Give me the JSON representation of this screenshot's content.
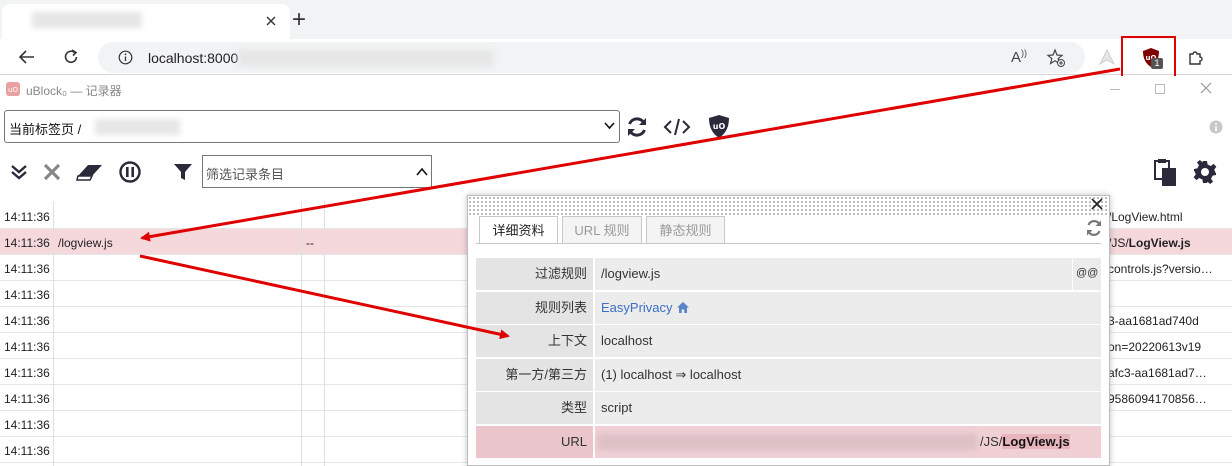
{
  "browser": {
    "address": "localhost:8000",
    "new_tab_symbol": "+",
    "extension_badge": "1"
  },
  "ublock": {
    "title": "uBlock₀ — 记录器",
    "tab_select_value": "当前标签页 / ",
    "filter_placeholder": "筛选记录条目",
    "icons": [
      "refresh-icon",
      "code-icon",
      "ublock-shield-icon",
      "expand-icon",
      "close-x-icon",
      "eraser-icon",
      "pause-icon",
      "filter-icon",
      "export-icon",
      "settings-gear-icon",
      "info-icon"
    ]
  },
  "log": {
    "rows": [
      {
        "time": "14:11:36",
        "name": "",
        "mid": "",
        "tail": "/LogView.html",
        "tail_bold": ""
      },
      {
        "time": "14:11:36",
        "name": "/logview.js",
        "mid": "--",
        "tail": "/JS/",
        "tail_bold": "LogView.js",
        "highlight": true
      },
      {
        "time": "14:11:36",
        "name": "",
        "mid": "",
        "tail": "controls.js?versio…",
        "tail_bold": ""
      },
      {
        "time": "14:11:36",
        "name": "",
        "mid": "",
        "tail": "",
        "tail_bold": ""
      },
      {
        "time": "14:11:36",
        "name": "",
        "mid": "",
        "tail": "3-aa1681ad740d",
        "tail_bold": ""
      },
      {
        "time": "14:11:36",
        "name": "",
        "mid": "",
        "tail": "on=20220613v19",
        "tail_bold": ""
      },
      {
        "time": "14:11:36",
        "name": "",
        "mid": "",
        "tail": "afc3-aa1681ad7…",
        "tail_bold": ""
      },
      {
        "time": "14:11:36",
        "name": "",
        "mid": "",
        "tail": "9586094170856…",
        "tail_bold": ""
      },
      {
        "time": "14:11:36",
        "name": "",
        "mid": "",
        "tail": "",
        "tail_bold": ""
      },
      {
        "time": "14:11:36",
        "name": "",
        "mid": "",
        "tail": "",
        "tail_bold": ""
      }
    ]
  },
  "details": {
    "tabs": [
      "详细资料",
      "URL 规则",
      "静态规则"
    ],
    "rows": [
      {
        "label": "过滤规则",
        "value": "/logview.js",
        "extra": "@@"
      },
      {
        "label": "规则列表",
        "value": "EasyPrivacy",
        "extra": ""
      },
      {
        "label": "上下文",
        "value": "localhost",
        "extra": ""
      },
      {
        "label": "第一方/第三方",
        "value": "(1)  localhost ⇒ localhost",
        "extra": ""
      },
      {
        "label": "类型",
        "value": "script",
        "extra": ""
      },
      {
        "label": "URL",
        "value": "/JS/",
        "value_bold": "LogView.js",
        "extra": ""
      }
    ]
  },
  "colors": {
    "highlight_row": "#f5d8dc",
    "link_blue": "#3a6fc4",
    "annotation_red": "#e00000"
  }
}
